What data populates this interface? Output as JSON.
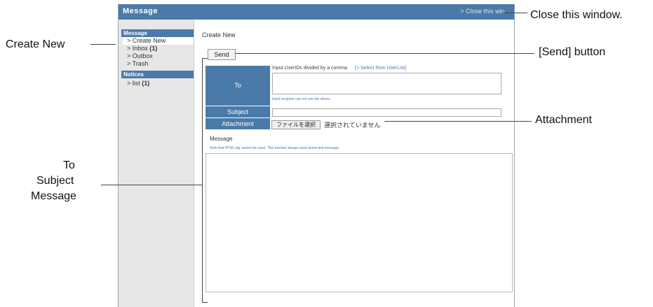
{
  "window": {
    "title": "Message",
    "close_link": "> Close this win..."
  },
  "sidebar": {
    "message_header": "Message",
    "items": [
      {
        "label": "> Create New"
      },
      {
        "label": "> Inbox",
        "count": "(1)"
      },
      {
        "label": "> Outbox"
      },
      {
        "label": "> Trash"
      }
    ],
    "notices_header": "Notices",
    "notice_items": [
      {
        "label": "> list",
        "count": "(1)"
      }
    ]
  },
  "main": {
    "title": "Create New",
    "send_label": "Send",
    "to": {
      "label": "To",
      "hint": "Input UserIDs divided by a comma",
      "select_link": "[> Select from UserList]",
      "note": "Each recipient can not see the others."
    },
    "subject": {
      "label": "Subject"
    },
    "attachment": {
      "label": "Attachment",
      "button": "ファイルを選択",
      "status": "選択されていません"
    },
    "message": {
      "label": "Message",
      "note": "Note that HTML tag cannot be used. This function always send plane-text message."
    }
  },
  "annotations": {
    "create_new": "Create  New",
    "close_window": "Close this window.",
    "send_button": "[Send] button",
    "attachment": "Attachment",
    "to": "To",
    "subject": "Subject",
    "message": "Message"
  }
}
